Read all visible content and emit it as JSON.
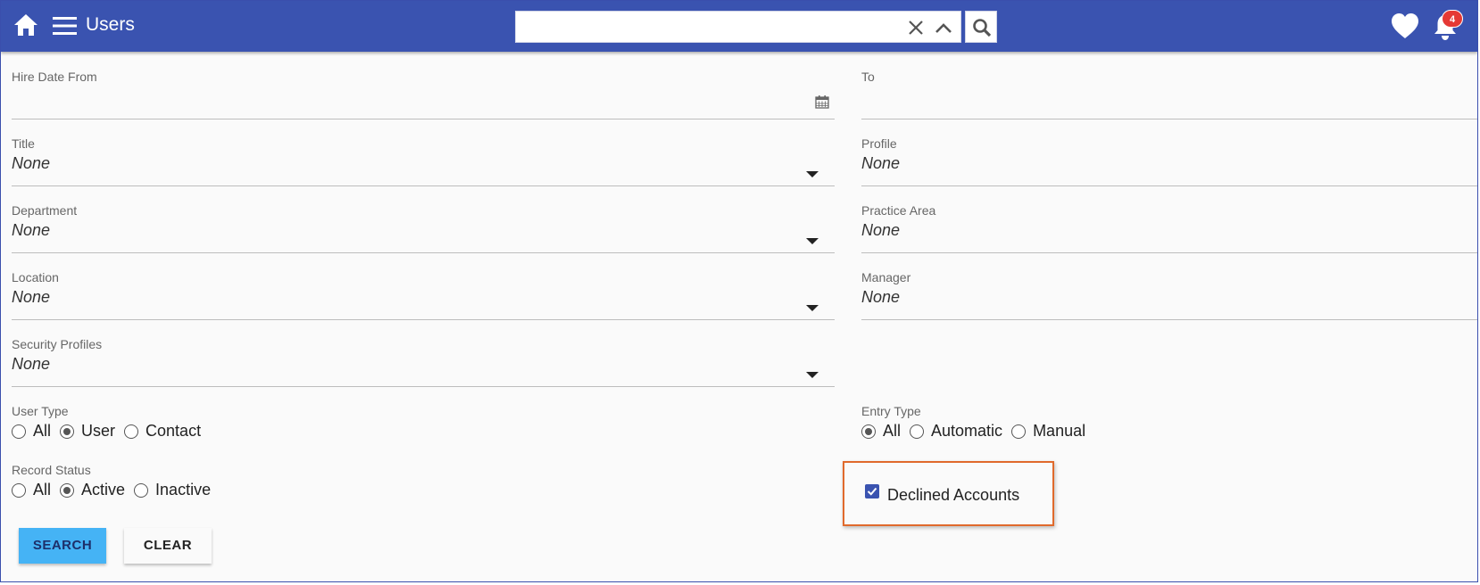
{
  "header": {
    "title": "Users",
    "search": {
      "value": "",
      "placeholder": ""
    },
    "notification_count": "4",
    "colors": {
      "bar": "#3a53b0",
      "badge": "#e53935"
    },
    "icons": [
      "home-icon",
      "hamburger-menu-icon",
      "clear-icon",
      "chevron-up-icon",
      "search-icon",
      "heart-icon",
      "bell-icon"
    ]
  },
  "form": {
    "hire_date_from": {
      "label": "Hire Date From",
      "value": ""
    },
    "hire_date_to": {
      "label": "To",
      "value": ""
    },
    "title": {
      "label": "Title",
      "value": "None"
    },
    "profile": {
      "label": "Profile",
      "value": "None"
    },
    "department": {
      "label": "Department",
      "value": "None"
    },
    "practice_area": {
      "label": "Practice Area",
      "value": "None"
    },
    "location": {
      "label": "Location",
      "value": "None"
    },
    "manager": {
      "label": "Manager",
      "value": "None"
    },
    "security_profiles": {
      "label": "Security Profiles",
      "value": "None"
    },
    "user_type": {
      "label": "User Type",
      "options": [
        "All",
        "User",
        "Contact"
      ],
      "selected": "User"
    },
    "entry_type": {
      "label": "Entry Type",
      "options": [
        "All",
        "Automatic",
        "Manual"
      ],
      "selected": "All"
    },
    "record_status": {
      "label": "Record Status",
      "options": [
        "All",
        "Active",
        "Inactive"
      ],
      "selected": "Active"
    },
    "declined_accounts": {
      "label": "Declined Accounts",
      "checked": true,
      "highlight_color": "#e06a2c"
    }
  },
  "actions": {
    "search_label": "SEARCH",
    "clear_label": "CLEAR",
    "search_color": "#45b3f5"
  }
}
